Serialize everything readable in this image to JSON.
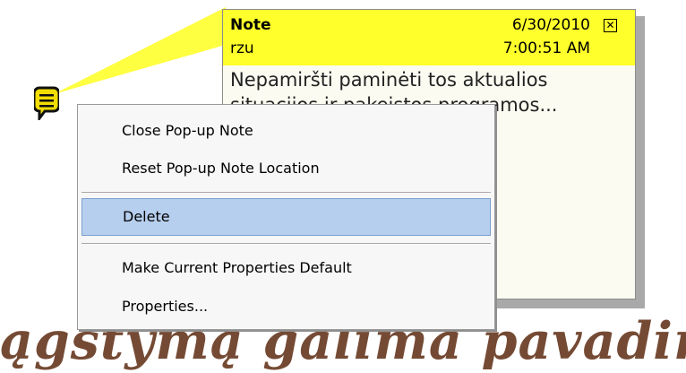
{
  "note": {
    "title": "Note",
    "author": "rzu",
    "date": "6/30/2010",
    "time": "7:00:51 AM",
    "close_symbol": "✕",
    "body": "Nepamiršti paminėti tos aktualios\nsituacijos ir pakeistos programos...",
    "colors": {
      "header": "#ffff2b",
      "body": "#fbfbf1"
    }
  },
  "annotation_icon": {
    "name": "note-icon",
    "color": "#f2de00"
  },
  "context_menu": {
    "items": [
      {
        "label": "Close Pop-up Note"
      },
      {
        "label": "Reset Pop-up Note Location"
      },
      {
        "label": "Delete",
        "selected": true
      },
      {
        "label": "Make Current Properties Default"
      },
      {
        "label": "Properties..."
      }
    ]
  },
  "document": {
    "text": "ągstymą galima pavadinti ek"
  }
}
